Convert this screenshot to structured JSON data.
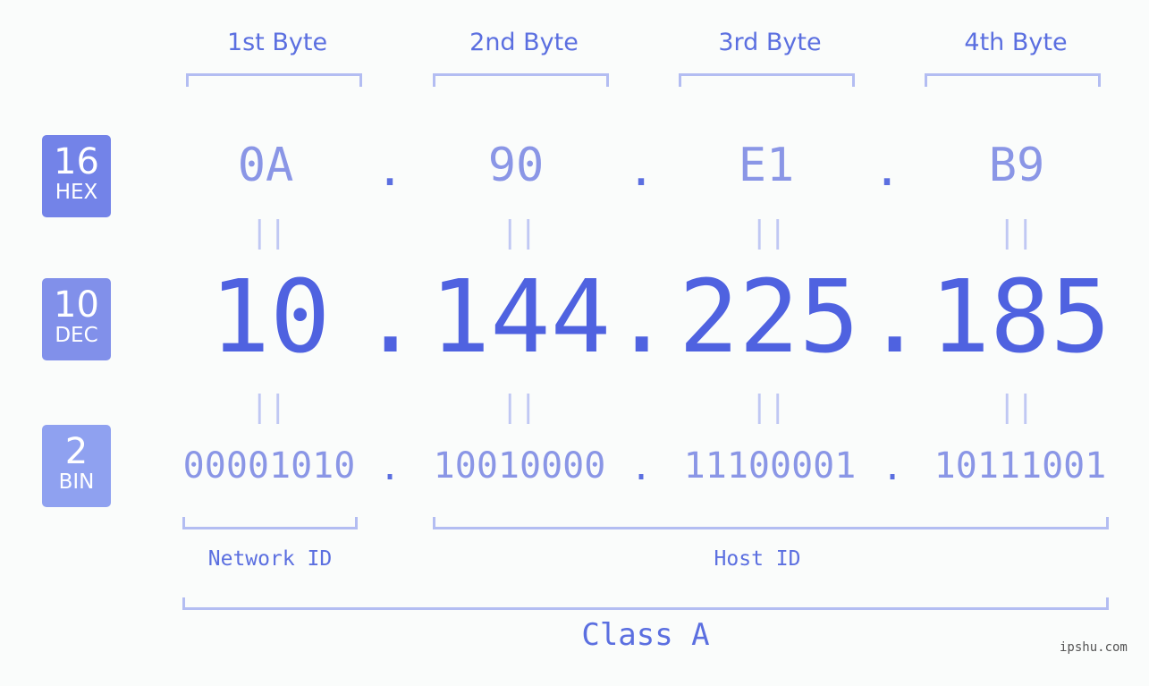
{
  "bytes": [
    {
      "label": "1st Byte",
      "hex": "0A",
      "dec": "10",
      "bin": "00001010"
    },
    {
      "label": "2nd Byte",
      "hex": "90",
      "dec": "144",
      "bin": "10010000"
    },
    {
      "label": "3rd Byte",
      "hex": "E1",
      "dec": "225",
      "bin": "11100001"
    },
    {
      "label": "4th Byte",
      "hex": "B9",
      "dec": "185",
      "bin": "10111001"
    }
  ],
  "badges": {
    "hex": {
      "num": "16",
      "sub": "HEX",
      "color": "#7383e8"
    },
    "dec": {
      "num": "10",
      "sub": "DEC",
      "color": "#8190ea"
    },
    "bin": {
      "num": "2",
      "sub": "BIN",
      "color": "#8fa1f0"
    }
  },
  "separator": ".",
  "equals": "||",
  "network_label": "Network ID",
  "host_label": "Host ID",
  "class_label": "Class A",
  "watermark": "ipshu.com"
}
